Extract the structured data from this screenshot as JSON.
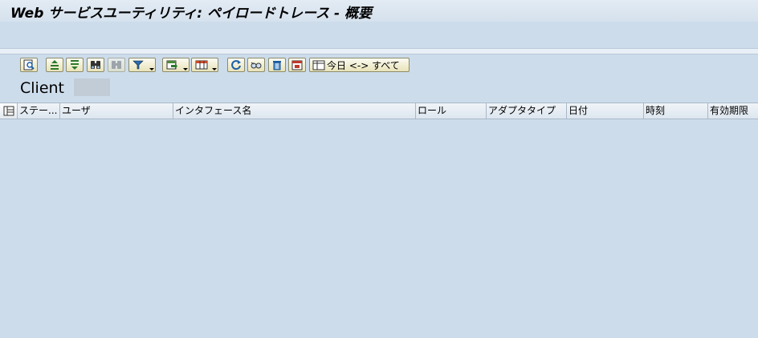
{
  "window": {
    "title": "Web サービスユーティリティ: ペイロードトレース - 概要"
  },
  "toolbar": {
    "today_all_label": "今日 <-> すべて",
    "icons": [
      "details-icon",
      "sort-ascending-icon",
      "sort-descending-icon",
      "find-icon",
      "find-next-icon",
      "filter-icon",
      "export-icon",
      "layout-icon",
      "refresh-icon",
      "glasses-icon",
      "delete-icon",
      "calendar-icon",
      "table-icon"
    ]
  },
  "client": {
    "label": "Client",
    "value": ""
  },
  "grid": {
    "columns": [
      "ステー...",
      "ユーザ",
      "インタフェース名",
      "ロール",
      "アダプタタイプ",
      "日付",
      "時刻",
      "有効期限"
    ]
  },
  "colors": {
    "background": "#cddceb",
    "button_face": "#f4f1d8",
    "header_face": "#e8eef4"
  }
}
